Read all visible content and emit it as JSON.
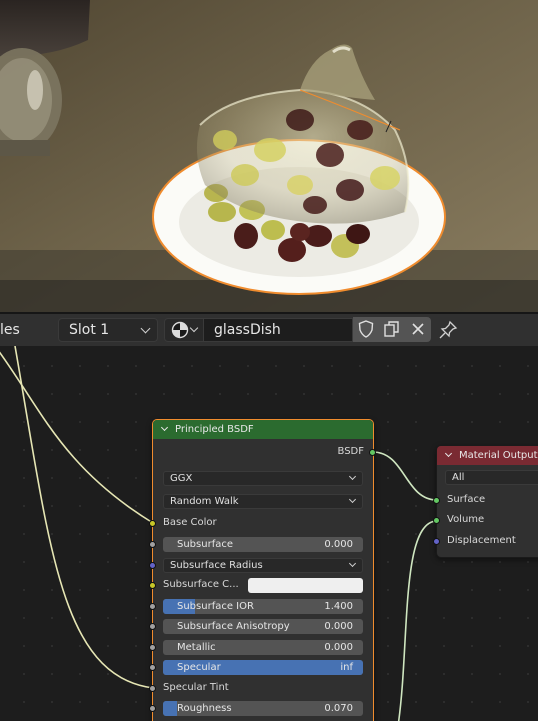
{
  "header": {
    "left_partial_label": "les",
    "slot_dropdown": "Slot 1",
    "material_name": "glassDish",
    "icons": [
      "material-sphere-icon",
      "fake-user-shield-icon",
      "duplicate-material-icon",
      "unlink-x-icon",
      "pin-icon"
    ]
  },
  "nodes": {
    "principled": {
      "title": "Principled BSDF",
      "header_color": "#2b6b2f",
      "output": "BSDF",
      "distribution": "GGX",
      "subsurface_method": "Random Walk",
      "inputs": {
        "base_color": "Base Color",
        "subsurface": {
          "label": "Subsurface",
          "value": "0.000"
        },
        "subsurface_radius": "Subsurface Radius",
        "subsurface_color": "Subsurface C...",
        "subsurface_ior": {
          "label": "Subsurface IOR",
          "value": "1.400",
          "fill": 0.16
        },
        "subsurface_anisotropy": {
          "label": "Subsurface Anisotropy",
          "value": "0.000"
        },
        "metallic": {
          "label": "Metallic",
          "value": "0.000"
        },
        "specular": {
          "label": "Specular",
          "value": "inf",
          "fill": 1.0
        },
        "specular_tint": "Specular Tint",
        "roughness": {
          "label": "Roughness",
          "value": "0.070",
          "fill": 0.07
        }
      }
    },
    "material_output": {
      "title": "Material Output",
      "header_color": "#7a2a32",
      "target": "All",
      "inputs": {
        "surface": "Surface",
        "volume": "Volume",
        "displacement": "Displacement"
      }
    }
  },
  "colors": {
    "accent_blue": "#4772b3",
    "selected_outline": "#f08c2e",
    "shader_socket": "#63c763",
    "color_socket": "#c7c729",
    "vector_socket": "#6363c7",
    "float_socket": "#a1a1a1",
    "link_color": "#e8e8c0"
  }
}
